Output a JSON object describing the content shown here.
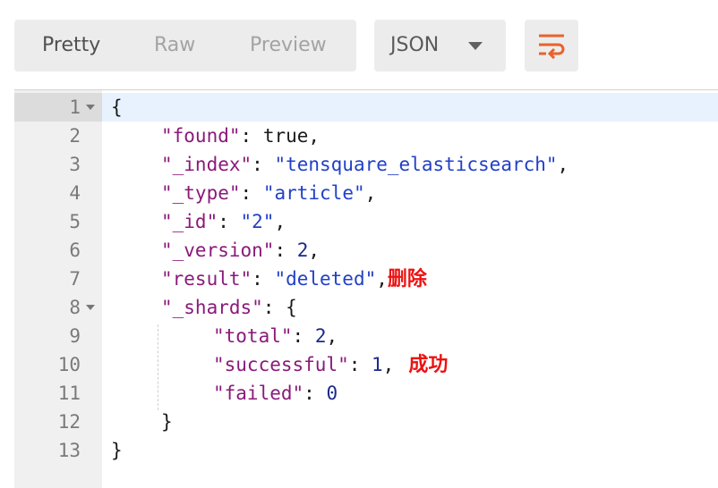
{
  "tabs": {
    "pretty": "Pretty",
    "raw": "Raw",
    "preview": "Preview"
  },
  "format": {
    "selected": "JSON"
  },
  "icons": {
    "wrap": "wrap-lines-icon",
    "caret": "chevron-down-icon"
  },
  "colors": {
    "accent": "#e8622d",
    "key": "#8a1a7a",
    "string": "#2140c8",
    "number": "#1b2a8a",
    "annotation": "#ee1111"
  },
  "editor": {
    "line_numbers": [
      "1",
      "2",
      "3",
      "4",
      "5",
      "6",
      "7",
      "8",
      "9",
      "10",
      "11",
      "12",
      "13"
    ],
    "lines": {
      "l1": {
        "open": "{"
      },
      "l2": {
        "key": "\"found\"",
        "sep": ": ",
        "val": "true",
        "end": ","
      },
      "l3": {
        "key": "\"_index\"",
        "sep": ": ",
        "val": "\"tensquare_elasticsearch\"",
        "end": ","
      },
      "l4": {
        "key": "\"_type\"",
        "sep": ": ",
        "val": "\"article\"",
        "end": ","
      },
      "l5": {
        "key": "\"_id\"",
        "sep": ": ",
        "val": "\"2\"",
        "end": ","
      },
      "l6": {
        "key": "\"_version\"",
        "sep": ": ",
        "val": "2",
        "end": ","
      },
      "l7": {
        "key": "\"result\"",
        "sep": ": ",
        "val": "\"deleted\"",
        "end": ","
      },
      "l8": {
        "key": "\"_shards\"",
        "sep": ": ",
        "val": "{"
      },
      "l9": {
        "key": "\"total\"",
        "sep": ": ",
        "val": "2",
        "end": ","
      },
      "l10": {
        "key": "\"successful\"",
        "sep": ": ",
        "val": "1",
        "end": ","
      },
      "l11": {
        "key": "\"failed\"",
        "sep": ": ",
        "val": "0"
      },
      "l12": {
        "close": "}"
      },
      "l13": {
        "close": "}"
      }
    },
    "annotations": {
      "deleted": "删除",
      "success": "成功"
    }
  }
}
